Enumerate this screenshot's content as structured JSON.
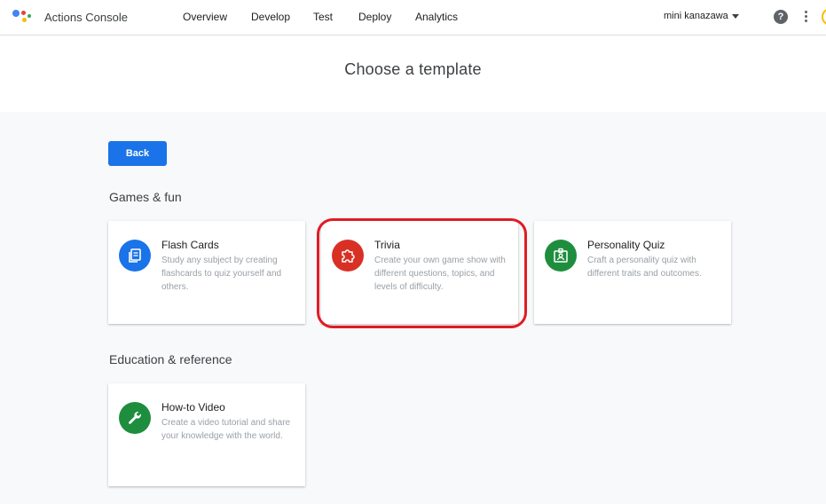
{
  "app": {
    "title": "Actions Console"
  },
  "nav": {
    "items": [
      "Overview",
      "Develop",
      "Test",
      "Deploy",
      "Analytics"
    ]
  },
  "user": {
    "name": "mini kanazawa"
  },
  "toolbar": {
    "help_label": "?"
  },
  "page": {
    "title": "Choose a template",
    "back_label": "Back"
  },
  "sections": [
    {
      "title": "Games & fun",
      "cards": [
        {
          "title": "Flash Cards",
          "description": "Study any subject by creating flashcards to quiz yourself and others.",
          "icon": "flash-cards-icon",
          "color": "#1a73e8"
        },
        {
          "title": "Trivia",
          "description": "Create your own game show with different questions, topics, and levels of difficulty.",
          "icon": "puzzle-icon",
          "color": "#d93025"
        },
        {
          "title": "Personality Quiz",
          "description": "Craft a personality quiz with different traits and outcomes.",
          "icon": "badge-icon",
          "color": "#1e8e3e"
        }
      ]
    },
    {
      "title": "Education & reference",
      "cards": [
        {
          "title": "How-to Video",
          "description": "Create a video tutorial and share your knowledge with the world.",
          "icon": "wrench-icon",
          "color": "#1e8e3e"
        }
      ]
    }
  ],
  "colors": {
    "accent": "#1a73e8",
    "highlight": "#e01b24"
  }
}
